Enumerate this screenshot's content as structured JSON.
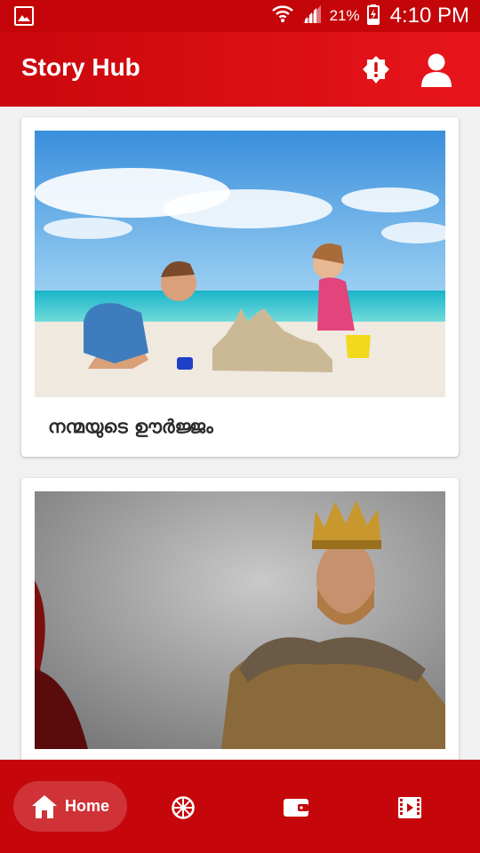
{
  "status_bar": {
    "battery": "21%",
    "time": "4:10 PM"
  },
  "app": {
    "title": "Story Hub"
  },
  "stories": [
    {
      "caption": "നന്മയുടെ ഊർജ്ജം"
    },
    {
      "caption": ""
    }
  ],
  "nav": {
    "home_label": "Home"
  },
  "colors": {
    "primary": "#c5060b",
    "appbar_end": "#e8151c",
    "card": "#ffffff",
    "background": "#f1f1f1"
  }
}
